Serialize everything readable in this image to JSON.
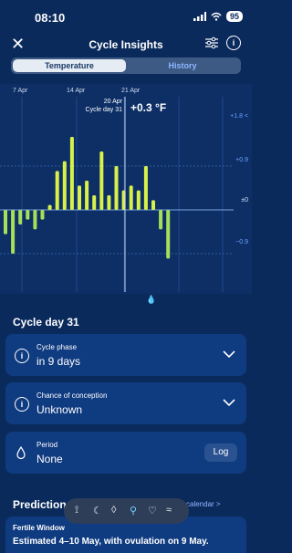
{
  "status": {
    "time": "08:10",
    "battery": "95"
  },
  "nav": {
    "title": "Cycle Insights"
  },
  "tabs": [
    {
      "label": "Temperature"
    },
    {
      "label": "History"
    }
  ],
  "chart_data": {
    "type": "bar",
    "xticks": [
      "7 Apr",
      "14 Apr",
      "21 Apr"
    ],
    "yticks": [
      "+1.8 <",
      "+0.9",
      "±0",
      "−0.9"
    ],
    "ylim": [
      -1.8,
      1.8
    ],
    "selected": {
      "date": "20 Apr",
      "cycle_day": "Cycle day 31",
      "value": "+0.3 °F"
    },
    "values": [
      -0.5,
      -0.9,
      -0.3,
      -0.2,
      -0.4,
      -0.2,
      0.1,
      0.8,
      1.0,
      1.5,
      0.5,
      0.6,
      0.3,
      1.2,
      0.3,
      0.9,
      0.4,
      0.5,
      0.4,
      0.9,
      0.2,
      -0.4,
      -1.0
    ]
  },
  "cycle": {
    "title": "Cycle day 31",
    "phase_title": "Cycle phase",
    "phase_value": "in 9 days",
    "conception_title": "Chance of conception",
    "conception_value": "Unknown",
    "period_title": "Period",
    "period_value": "None",
    "log_label": "Log"
  },
  "predictions": {
    "title": "Predictions",
    "link": "w calendar >",
    "card_title": "Fertile Window",
    "card_text": "Estimated 4–10 May, with ovulation on 9 May."
  },
  "colors": {
    "bar_high": "#d8f14a",
    "bar_low": "#a6e05a",
    "grid": "#3b6bb0"
  }
}
